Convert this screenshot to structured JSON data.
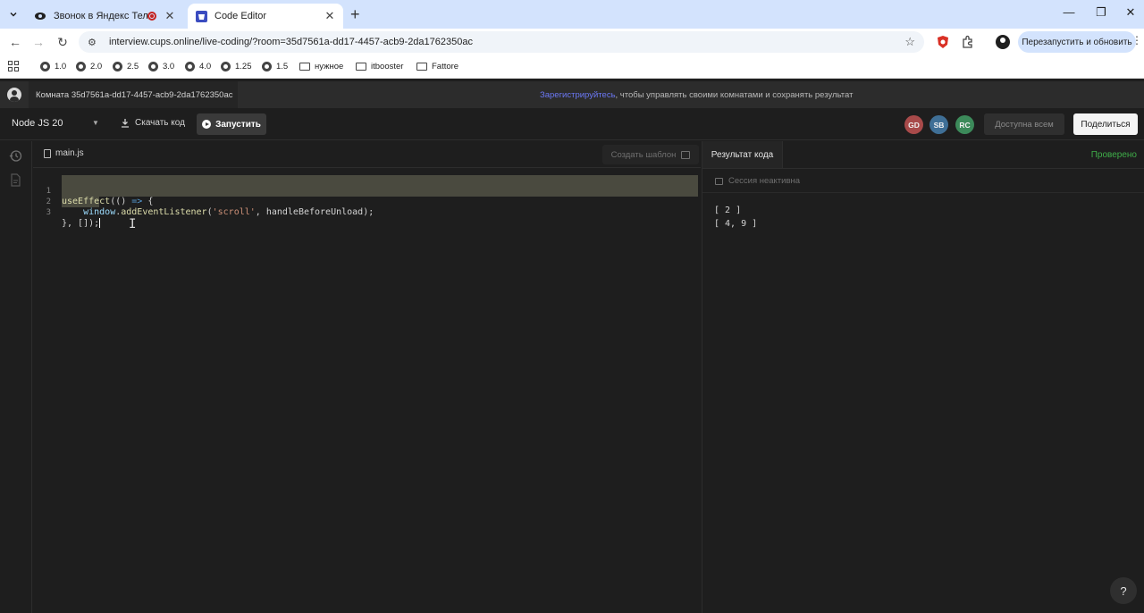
{
  "browser": {
    "tabs": [
      {
        "title": "Звонок в Яндекс Телемост",
        "icon": "telemost-icon"
      },
      {
        "title": "Code Editor",
        "icon": "cups-icon"
      }
    ],
    "url": "interview.cups.online/live-coding/?room=35d7561a-dd17-4457-acb9-2da1762350ac",
    "relaunch_label": "Перезапустить и обновить",
    "bookmarks": [
      "1.0",
      "2.0",
      "2.5",
      "3.0",
      "4.0",
      "1.25",
      "1.5",
      "нужное",
      "itbooster",
      "Fattore"
    ]
  },
  "app": {
    "room_label": "Комната 35d7561a-dd17-4457-acb9-2da1762350ac",
    "register_link": "Зарегистрируйтесь",
    "register_text": ", чтобы управлять своими комнатами и сохранять результат",
    "toolbar": {
      "language": "Node JS 20",
      "download_label": "Скачать код",
      "run_label": "Запустить",
      "avatars": [
        {
          "initials": "GD",
          "color": "#a84a4a"
        },
        {
          "initials": "SB",
          "color": "#3f6f96"
        },
        {
          "initials": "RC",
          "color": "#3c8a5a"
        }
      ],
      "access_label": "Доступна всем",
      "share_label": "Поделиться"
    },
    "editor": {
      "file_name": "main.js",
      "template_label": "Создать шаблон",
      "line_numbers": [
        "1",
        "2",
        "3"
      ],
      "code": [
        "useEffect(() => {",
        "    window.addEventListener('scroll', handleBeforeUnload);",
        "}, []);"
      ]
    },
    "result": {
      "tab_label": "Результат кода",
      "status": "Проверено",
      "session_label": "Сессия неактивна",
      "output": [
        "[ 2 ]",
        "[ 4, 9 ]"
      ]
    },
    "help_label": "?"
  }
}
